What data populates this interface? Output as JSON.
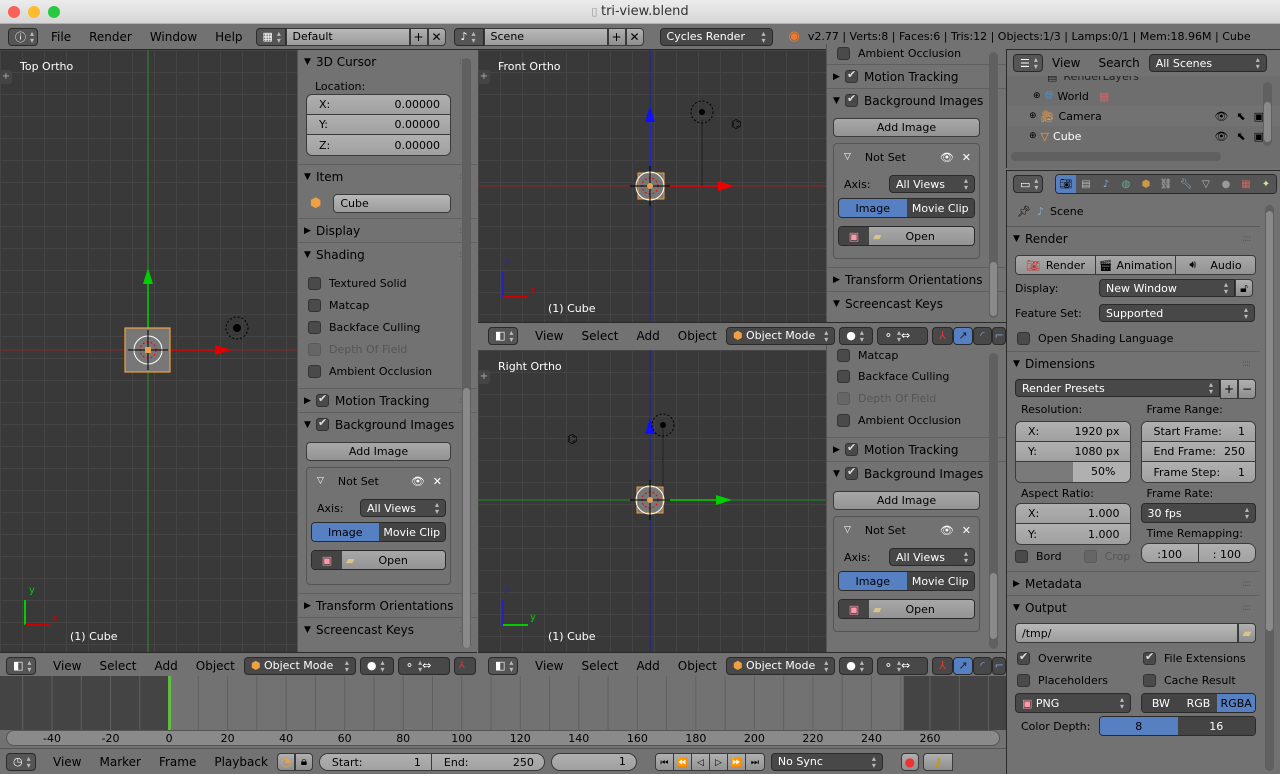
{
  "window": {
    "title": "tri-view.blend"
  },
  "info_header": {
    "menus": [
      "File",
      "Render",
      "Window",
      "Help"
    ],
    "layout": "Default",
    "scene": "Scene",
    "engine": "Cycles Render",
    "stats": "v2.77 | Verts:8 | Faces:6 | Tris:12 | Objects:1/3 | Lamps:0/1 | Mem:18.96M | Cube"
  },
  "viewports": {
    "top": {
      "label": "Top Ortho",
      "object": "(1) Cube",
      "axis_a": "y",
      "axis_b": "x"
    },
    "front": {
      "label": "Front Ortho",
      "object": "(1) Cube",
      "axis_a": "z",
      "axis_b": "x"
    },
    "right": {
      "label": "Right Ortho",
      "object": "(1) Cube",
      "axis_a": "z",
      "axis_b": "y"
    }
  },
  "view_header": {
    "menus": [
      "View",
      "Select",
      "Add",
      "Object"
    ],
    "mode": "Object Mode"
  },
  "npanel_left": {
    "cursor_title": "3D Cursor",
    "location_label": "Location:",
    "loc": [
      {
        "k": "X:",
        "v": "0.00000"
      },
      {
        "k": "Y:",
        "v": "0.00000"
      },
      {
        "k": "Z:",
        "v": "0.00000"
      }
    ],
    "item_title": "Item",
    "item_name": "Cube",
    "display_title": "Display",
    "shading_title": "Shading",
    "shading_opts": [
      "Textured Solid",
      "Matcap",
      "Backface Culling",
      "Depth Of Field",
      "Ambient Occlusion"
    ],
    "motion_tracking": "Motion Tracking",
    "bg_images": "Background Images",
    "add_image": "Add Image",
    "not_set": "Not Set",
    "axis_label": "Axis:",
    "axis_value": "All Views",
    "image_tab": "Image",
    "movie_tab": "Movie Clip",
    "open": "Open",
    "transform_orient": "Transform Orientations",
    "screencast": "Screencast Keys"
  },
  "npanel_mid_top": {
    "ambient": "Ambient Occlusion"
  },
  "npanel_mid_bottom": {
    "opts": [
      "Matcap",
      "Backface Culling",
      "Depth Of Field",
      "Ambient Occlusion"
    ]
  },
  "outliner": {
    "menus": [
      "View",
      "Search"
    ],
    "filter": "All Scenes",
    "items": [
      {
        "name": "RenderLayers"
      },
      {
        "name": "World"
      },
      {
        "name": "Camera"
      },
      {
        "name": "Cube"
      }
    ]
  },
  "properties": {
    "context": "Scene",
    "render": {
      "title": "Render",
      "buttons": [
        "Render",
        "Animation",
        "Audio"
      ],
      "display_label": "Display:",
      "display_value": "New Window",
      "feature_label": "Feature Set:",
      "feature_value": "Supported",
      "osl": "Open Shading Language"
    },
    "dimensions": {
      "title": "Dimensions",
      "presets": "Render Presets",
      "resolution_label": "Resolution:",
      "res_x": {
        "k": "X:",
        "v": "1920 px"
      },
      "res_y": {
        "k": "Y:",
        "v": "1080 px"
      },
      "res_pct": "50%",
      "res_pct_value": 0.5,
      "frame_range_label": "Frame Range:",
      "start": {
        "k": "Start Frame:",
        "v": "1"
      },
      "end": {
        "k": "End Frame:",
        "v": "250"
      },
      "step": {
        "k": "Frame Step:",
        "v": "1"
      },
      "aspect_label": "Aspect Ratio:",
      "asp_x": {
        "k": "X:",
        "v": "1.000"
      },
      "asp_y": {
        "k": "Y:",
        "v": "1.000"
      },
      "fps_label": "Frame Rate:",
      "fps": "30 fps",
      "remap_label": "Time Remapping:",
      "remap_old": ":100",
      "remap_new": ": 100",
      "border": "Bord",
      "crop": "Crop"
    },
    "metadata": "Metadata",
    "output": {
      "title": "Output",
      "path": "/tmp/",
      "overwrite": "Overwrite",
      "file_ext": "File Extensions",
      "placeholders": "Placeholders",
      "cache": "Cache Result",
      "format": "PNG",
      "color_modes": [
        "BW",
        "RGB",
        "RGBA"
      ],
      "color_active": "RGBA",
      "depth_label": "Color Depth:",
      "depths": [
        "8",
        "16"
      ],
      "depth_active": "8"
    }
  },
  "timeline": {
    "ticks": [
      "-40",
      "-20",
      "0",
      "20",
      "40",
      "60",
      "80",
      "100",
      "120",
      "140",
      "160",
      "180",
      "200",
      "220",
      "240",
      "260"
    ],
    "current_frame": 0,
    "menus": [
      "View",
      "Marker",
      "Frame",
      "Playback"
    ],
    "start_label": "Start:",
    "start": "1",
    "end_label": "End:",
    "end": "250",
    "frame": "1",
    "sync": "No Sync"
  }
}
